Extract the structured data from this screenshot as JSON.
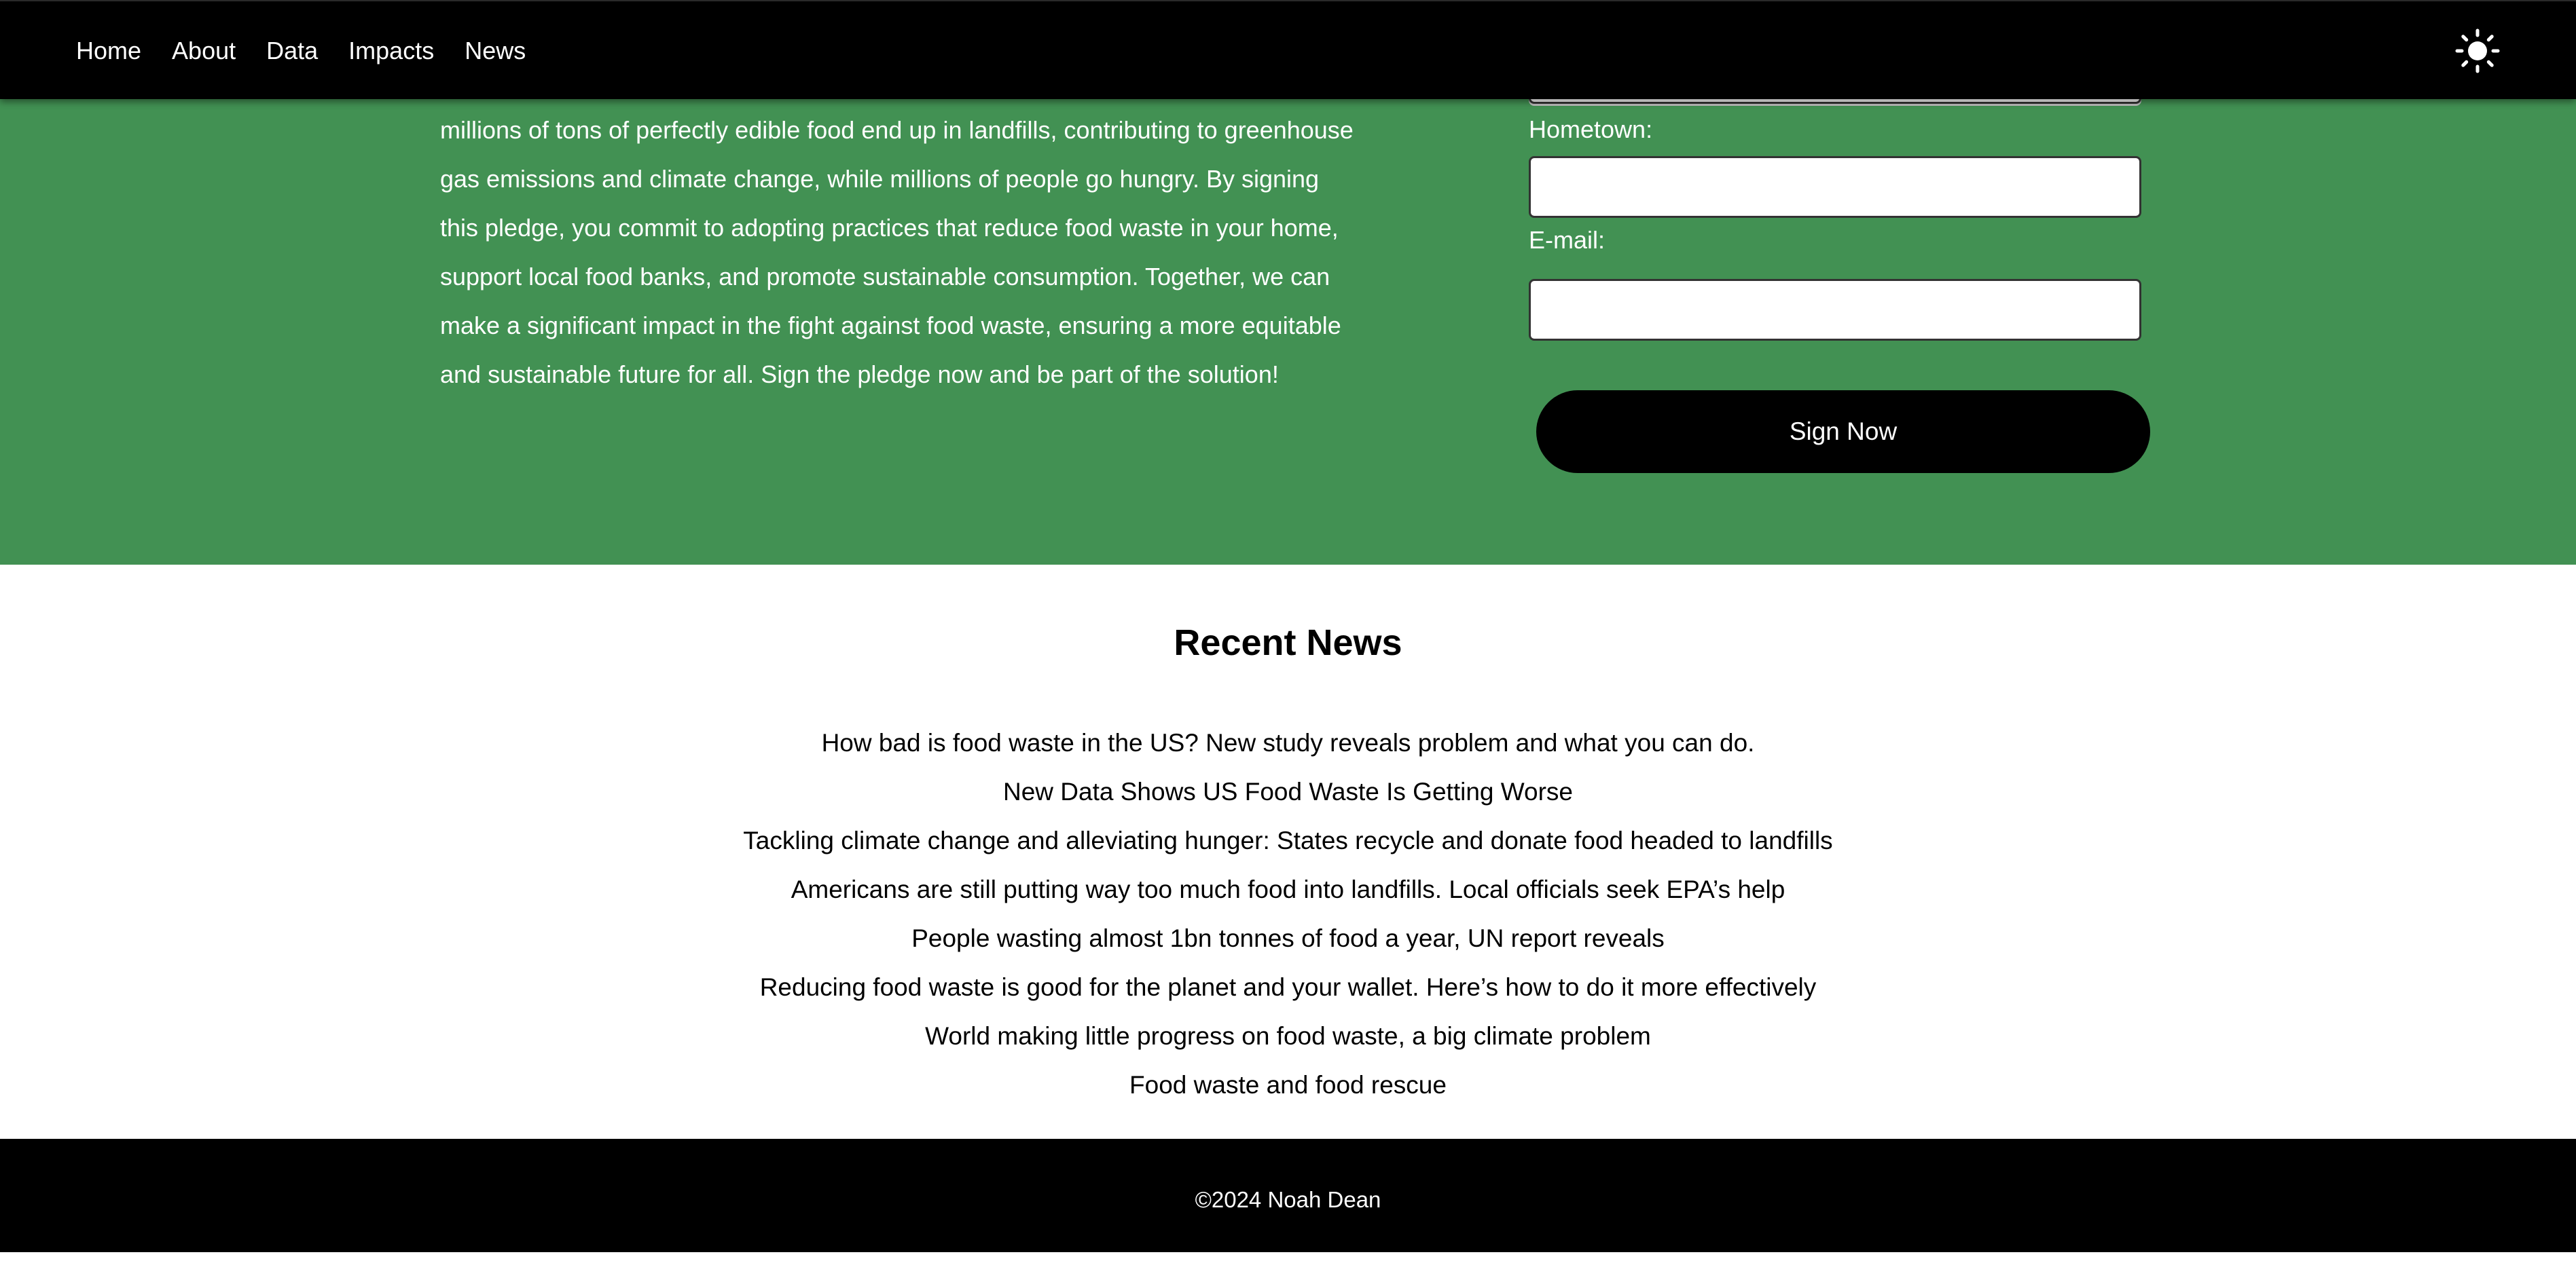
{
  "nav": {
    "links": [
      "Home",
      "About",
      "Data",
      "Impacts",
      "News"
    ],
    "theme_toggle_icon": "sun-icon"
  },
  "pledge": {
    "body": "millions of tons of perfectly edible food end up in landfills, contributing to greenhouse gas emissions and climate change, while millions of people go hungry. By signing this pledge, you commit to adopting practices that reduce food waste in your home, support local food banks, and promote sustainable consumption. Together, we can make a significant impact in the fight against food waste, ensuring a more equitable and sustainable future for all. Sign the pledge now and be part of the solution!",
    "form": {
      "hometown_label": "Hometown:",
      "hometown_value": "",
      "email_label": "E-mail:",
      "email_value": "",
      "submit_label": "Sign Now"
    }
  },
  "news": {
    "title": "Recent News",
    "items": [
      "How bad is food waste in the US? New study reveals problem and what you can do.",
      "New Data Shows US Food Waste Is Getting Worse",
      "Tackling climate change and alleviating hunger: States recycle and donate food headed to landfills",
      "Americans are still putting way too much food into landfills. Local officials seek EPA’s help",
      "People wasting almost 1bn tonnes of food a year, UN report reveals",
      "Reducing food waste is good for the planet and your wallet. Here’s how to do it more effectively",
      "World making little progress on food waste, a big climate problem",
      "Food waste and food rescue"
    ]
  },
  "footer": {
    "text": "©2024 Noah Dean"
  },
  "colors": {
    "nav_bg": "#000000",
    "pledge_bg": "#429153",
    "news_bg": "#ffffff",
    "footer_bg": "#000000",
    "button_bg": "#000000",
    "text_on_dark": "#ffffff"
  }
}
